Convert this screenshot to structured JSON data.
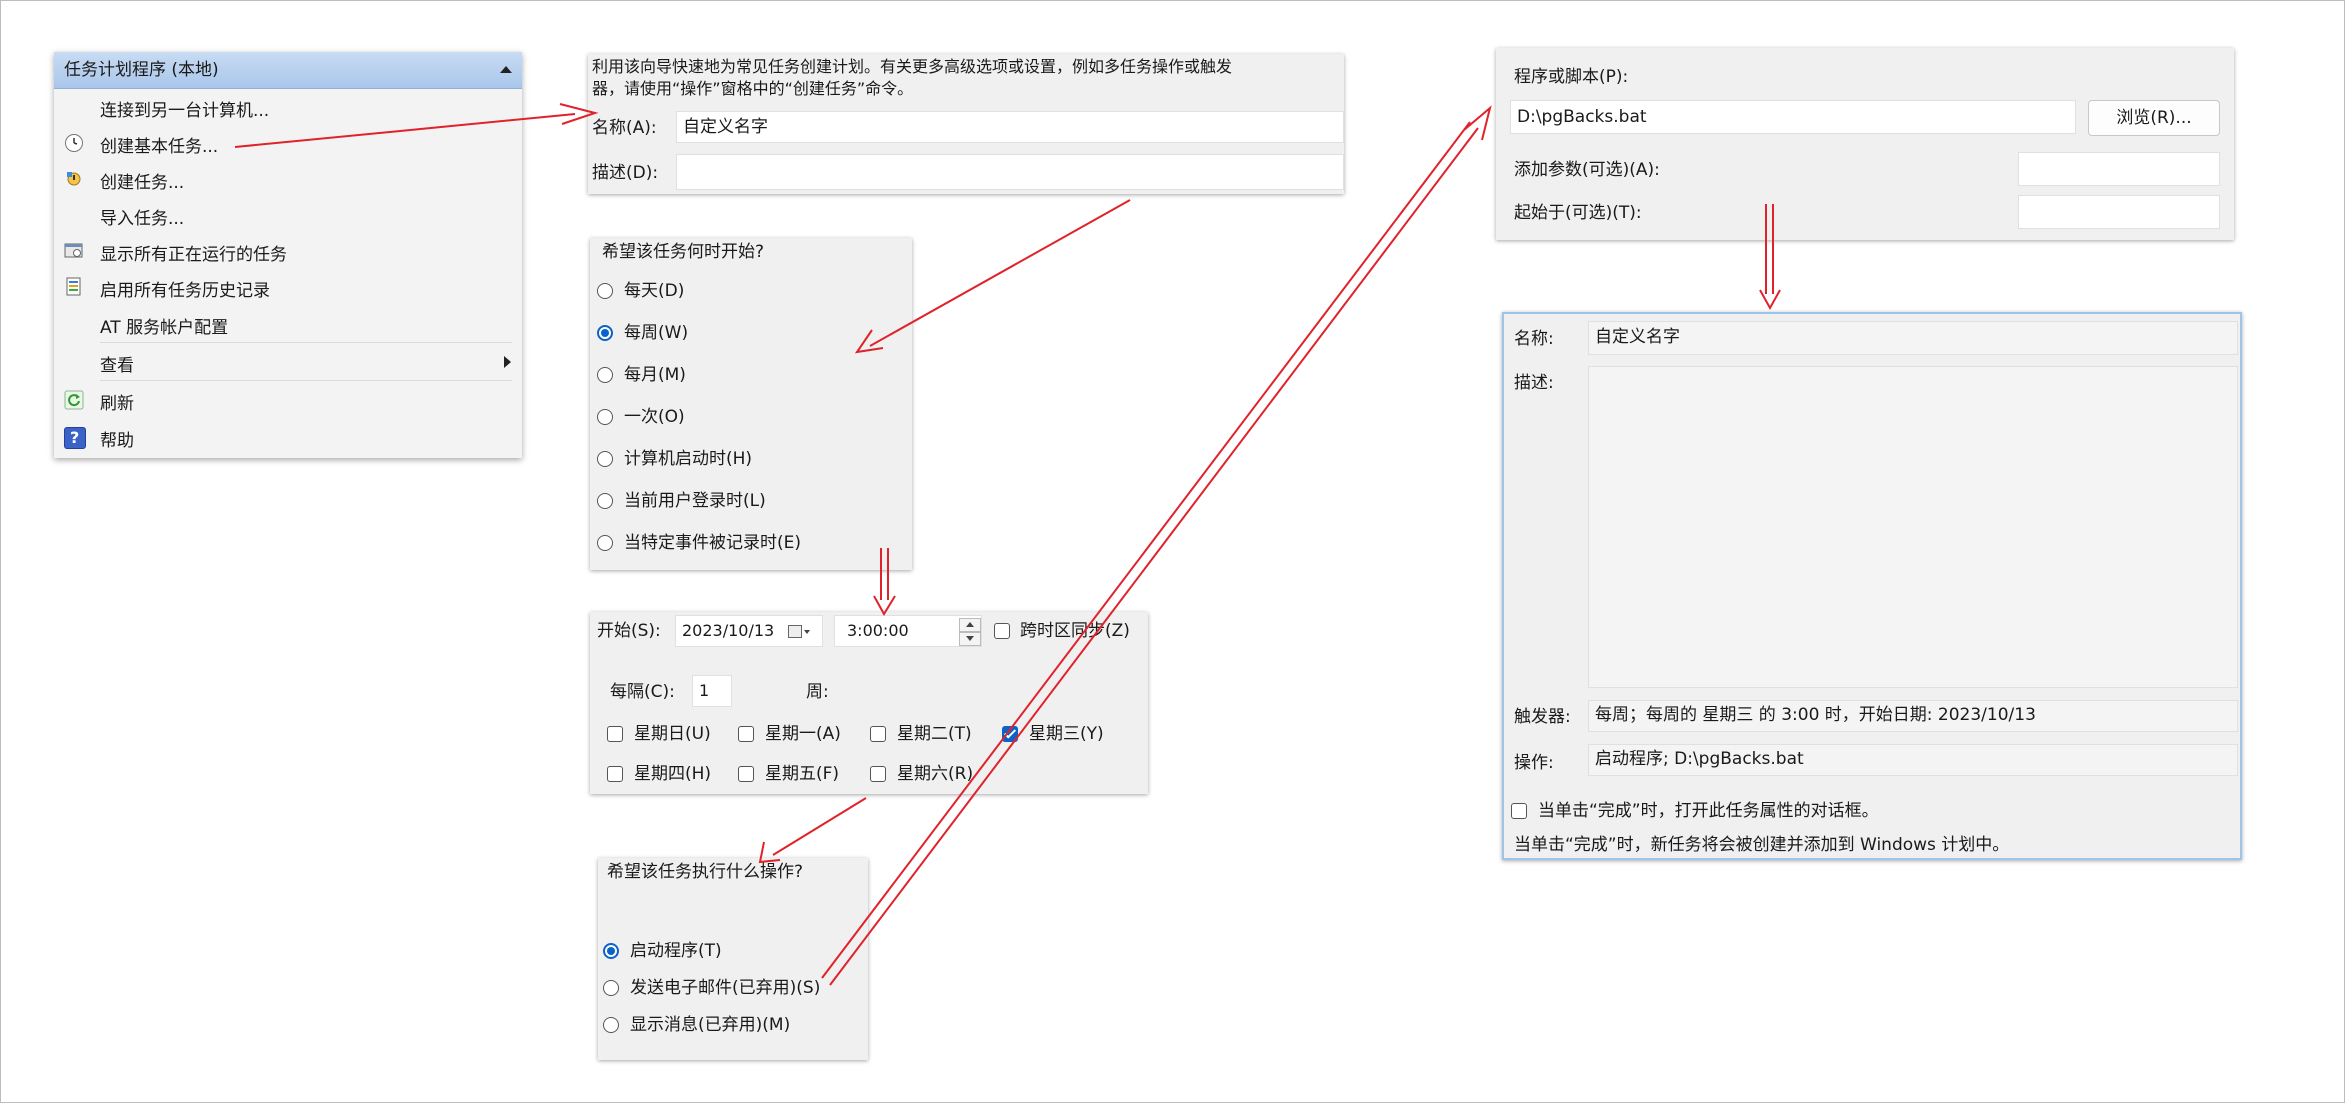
{
  "menu": {
    "title": "任务计划程序 (本地)",
    "items": [
      {
        "label": "连接到另一台计算机...",
        "icon": ""
      },
      {
        "label": "创建基本任务...",
        "icon": "task-wizard-icon"
      },
      {
        "label": "创建任务...",
        "icon": "create-task-icon"
      },
      {
        "label": "导入任务...",
        "icon": ""
      },
      {
        "label": "显示所有正在运行的任务",
        "icon": "running-tasks-icon"
      },
      {
        "label": "启用所有任务历史记录",
        "icon": "history-icon"
      },
      {
        "label": "AT 服务帐户配置",
        "icon": ""
      },
      {
        "label": "查看",
        "icon": ""
      },
      {
        "label": "刷新",
        "icon": "refresh-icon"
      },
      {
        "label": "帮助",
        "icon": "help-icon"
      }
    ]
  },
  "basic": {
    "intro": [
      "利用该向导快速地为常见任务创建计划。有关更多高级选项或设置，例如多任务操作或触发",
      "器，请使用“操作”窗格中的“创建任务”命令。"
    ],
    "name_label": "名称(A):",
    "name_value": "自定义名字",
    "desc_label": "描述(D):",
    "desc_value": ""
  },
  "trigger": {
    "question": "希望该任务何时开始?",
    "options": [
      "每天(D)",
      "每周(W)",
      "每月(M)",
      "一次(O)",
      "计算机启动时(H)",
      "当前用户登录时(L)",
      "当特定事件被记录时(E)"
    ],
    "selected_index": 1
  },
  "weekly": {
    "start_label": "开始(S):",
    "date": "2023/10/13",
    "time": "3:00:00",
    "sync_label": "跨时区同步(Z)",
    "every_label": "每隔(C):",
    "every_value": "1",
    "unit": "周:",
    "days": [
      "星期日(U)",
      "星期一(A)",
      "星期二(T)",
      "星期三(Y)",
      "星期四(H)",
      "星期五(F)",
      "星期六(R)"
    ],
    "checked_day_index": 3
  },
  "action": {
    "question": "希望该任务执行什么操作?",
    "options": [
      "启动程序(T)",
      "发送电子邮件(已弃用)(S)",
      "显示消息(已弃用)(M)"
    ],
    "selected_index": 0
  },
  "program": {
    "label": "程序或脚本(P):",
    "value": "D:\\pgBacks.bat",
    "browse": "浏览(R)...",
    "args_label": "添加参数(可选)(A):",
    "args_value": "",
    "start_in_label": "起始于(可选)(T):",
    "start_in_value": ""
  },
  "summary": {
    "name_label": "名称:",
    "name_value": "自定义名字",
    "desc_label": "描述:",
    "desc_value": "",
    "trigger_label": "触发器:",
    "trigger_value": "每周；每周的 星期三 的 3:00 时，开始日期: 2023/10/13",
    "action_label": "操作:",
    "action_value": "启动程序; D:\\pgBacks.bat",
    "open_props_label": "当单击“完成”时，打开此任务属性的对话框。",
    "finish_note": "当单击“完成”时，新任务将会被创建并添加到 Windows 计划中。"
  },
  "colors": {
    "arrow": "#e0222b",
    "accent": "#0a63c9",
    "menu_header": "#b5cfee"
  }
}
